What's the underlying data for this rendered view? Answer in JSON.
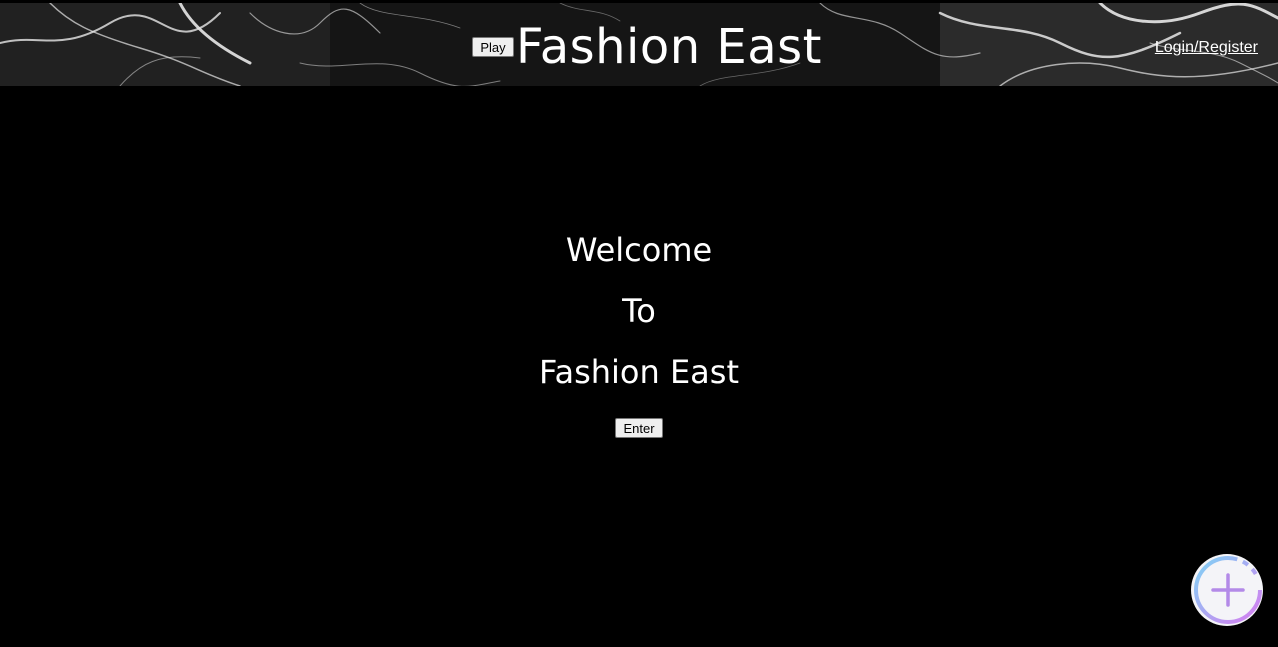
{
  "header": {
    "play_label": "Play",
    "title": "Fashion East",
    "login_label": "Login/Register"
  },
  "welcome": {
    "lines": [
      "Welcome",
      "To",
      "Fashion East"
    ],
    "enter_label": "Enter"
  },
  "fab": {
    "icon": "plus-icon"
  },
  "colors": {
    "background": "#000000",
    "text": "#ffffff",
    "fab_gradient_start": "#7fd3f5",
    "fab_gradient_end": "#d77cf0"
  }
}
